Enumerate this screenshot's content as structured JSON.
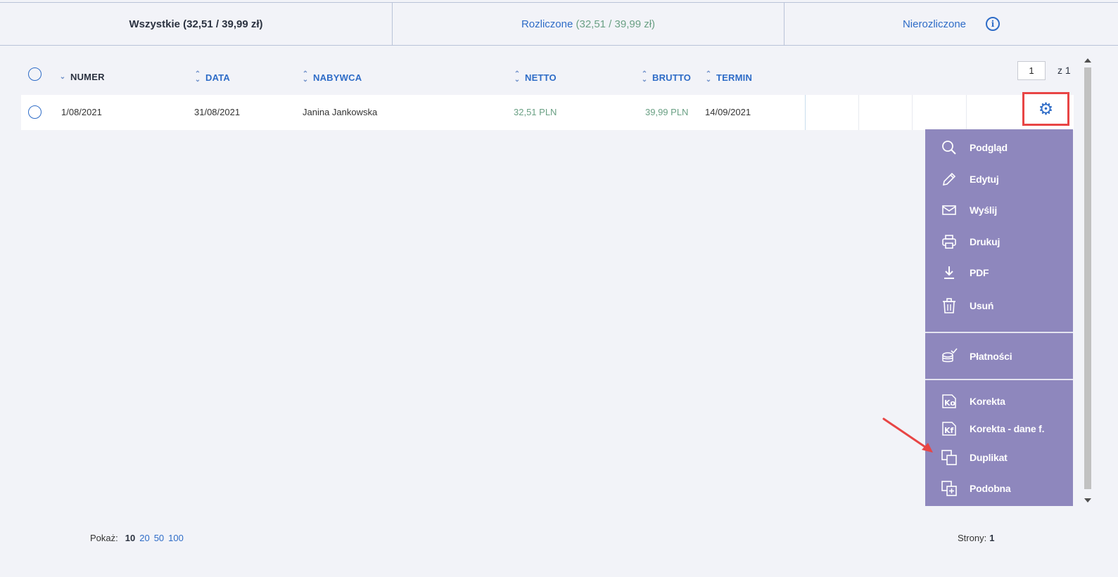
{
  "tabs": {
    "all_label": "Wszystkie (32,51 / 39,99 zł)",
    "settled_label": "Rozliczone",
    "settled_amount": "(32,51 / 39,99 zł)",
    "unsettled_label": "Nierozliczone",
    "info_glyph": "i"
  },
  "table": {
    "headers": {
      "numer": "NUMER",
      "data": "DATA",
      "nabywca": "NABYWCA",
      "netto": "NETTO",
      "brutto": "BRUTTO",
      "termin": "TERMIN"
    },
    "rows": [
      {
        "numer": "1/08/2021",
        "data": "31/08/2021",
        "nabywca": "Janina Jankowska",
        "netto": "32,51 PLN",
        "brutto": "39,99 PLN",
        "termin": "14/09/2021"
      }
    ]
  },
  "pagination": {
    "page_value": "1",
    "page_of": "z 1"
  },
  "actions_menu": {
    "items": [
      {
        "label": "Podgląd",
        "icon": "search-icon"
      },
      {
        "label": "Edytuj",
        "icon": "pencil-icon"
      },
      {
        "label": "Wyślij",
        "icon": "envelope-icon"
      },
      {
        "label": "Drukuj",
        "icon": "printer-icon"
      },
      {
        "label": "PDF",
        "icon": "download-icon"
      },
      {
        "label": "Usuń",
        "icon": "trash-icon"
      },
      {
        "label": "Płatności",
        "icon": "coins-check-icon"
      },
      {
        "label": "Korekta",
        "icon": "correction-document-icon"
      },
      {
        "label": "Korekta - dane f.",
        "icon": "correction-data-icon"
      },
      {
        "label": "Duplikat",
        "icon": "duplicate-icon"
      },
      {
        "label": "Podobna",
        "icon": "copy-add-icon"
      }
    ]
  },
  "footer": {
    "show_label": "Pokaż:",
    "show_active": "10",
    "show_options": [
      "20",
      "50",
      "100"
    ],
    "pages_label": "Strony:",
    "pages_value": "1"
  },
  "colors": {
    "accent": "#2e6cc7",
    "menu_bg": "#8e87bd",
    "amount_green": "#6aa084",
    "highlight_red": "#e84545"
  }
}
